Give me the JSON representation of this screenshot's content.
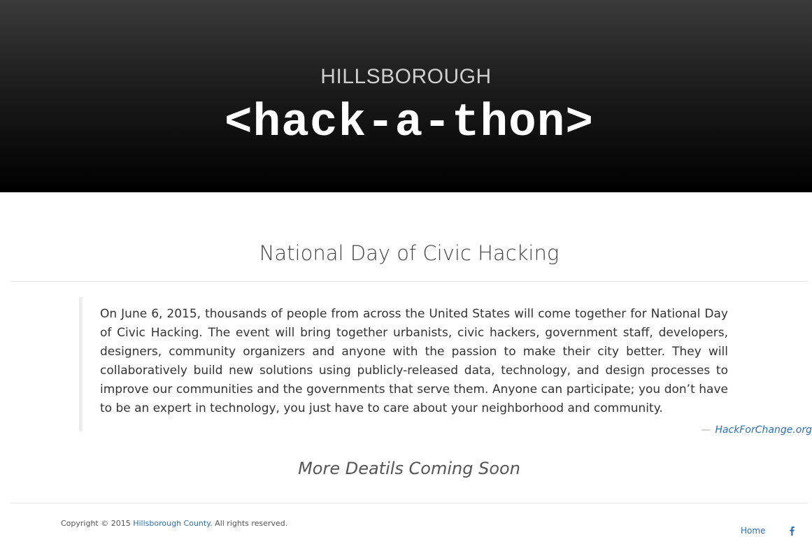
{
  "hero": {
    "subtitle": "HILLSBOROUGH",
    "title": "<hack-a-thon>"
  },
  "main": {
    "section_title": "National Day of Civic Hacking",
    "quote": {
      "text": "On June 6, 2015, thousands of people from across the United States will come together for National Day of Civic Hacking. The event will bring together urbanists, civic hackers, government staff, developers, designers, community organizers and anyone with the passion to make their city better. They will collaboratively build new solutions using publicly-released data, technology, and design processes to improve our communities and the governments that serve them. Anyone can participate; you don’t have to be an expert in technology, you just have to care about your neighborhood and community.",
      "dash": "—",
      "source": "HackForChange.org"
    },
    "coming_soon": "More Deatils Coming Soon"
  },
  "footer": {
    "copyright_prefix": "Copyright © 2015 ",
    "copyright_link": "Hillsborough County",
    "copyright_suffix": ". All rights reserved.",
    "nav_home": "Home",
    "social_icon": "facebook-icon"
  },
  "colors": {
    "link": "#2a6fc0",
    "hero_bg": "#000000"
  }
}
